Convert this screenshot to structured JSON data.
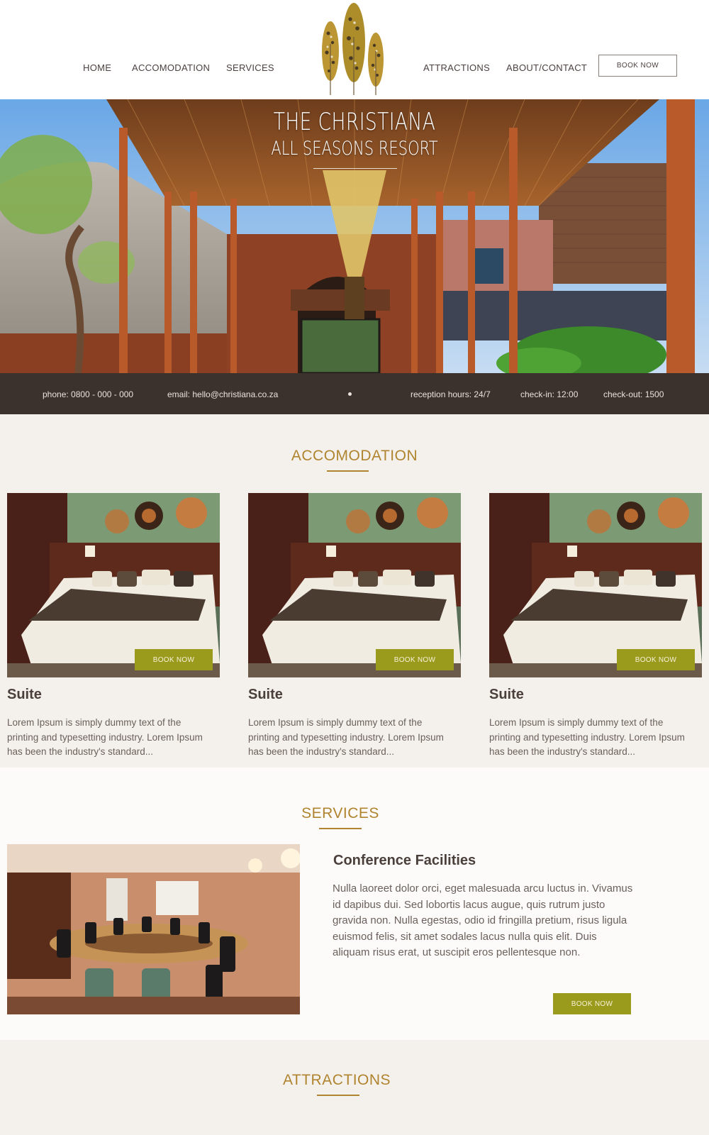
{
  "nav": {
    "left": [
      "HOME",
      "ACCOMODATION",
      "SERVICES"
    ],
    "right": [
      "ATTRACTIONS",
      "ABOUT/CONTACT"
    ],
    "book_now": "BOOK NOW",
    "logo_icon": "tree-logo-icon"
  },
  "hero": {
    "title_line1": "THE CHRISTIANA",
    "title_line2": "ALL SEASONS RESORT"
  },
  "info_bar": {
    "phone": "phone: 0800 - 000 - 000",
    "email": "email: hello@christiana.co.za",
    "reception": "reception hours: 24/7",
    "checkin": "check-in: 12:00",
    "checkout": "check-out: 1500"
  },
  "accomodation": {
    "heading": "ACCOMODATION",
    "rooms": [
      {
        "title": "Suite",
        "text": "Lorem Ipsum is simply dummy text of the printing and typesetting industry. Lorem Ipsum has been the industry's standard...",
        "button": "BOOK NOW"
      },
      {
        "title": "Suite",
        "text": "Lorem Ipsum is simply dummy text of the printing and typesetting industry. Lorem Ipsum has been the industry's standard...",
        "button": "BOOK NOW"
      },
      {
        "title": "Suite",
        "text": "Lorem Ipsum is simply dummy text of the printing and typesetting industry. Lorem Ipsum has been the industry's standard...",
        "button": "BOOK NOW"
      }
    ]
  },
  "services": {
    "heading": "SERVICES",
    "title": "Conference Facilities",
    "text": "Nulla laoreet dolor orci, eget malesuada arcu luctus in. Vivamus id dapibus dui. Sed lobortis lacus augue, quis rutrum justo gravida non. Nulla egestas, odio id fringilla pretium, risus ligula euismod felis, sit amet sodales lacus nulla quis elit. Duis aliquam risus erat, ut suscipit eros pellentesque non.",
    "button": "BOOK NOW"
  },
  "attractions": {
    "heading": "ATTRACTIONS"
  },
  "colors": {
    "accent_gold": "#b0842f",
    "button_olive": "#9a9a1d",
    "info_bar": "#3b322e",
    "page_bg": "#f4f1ec"
  }
}
